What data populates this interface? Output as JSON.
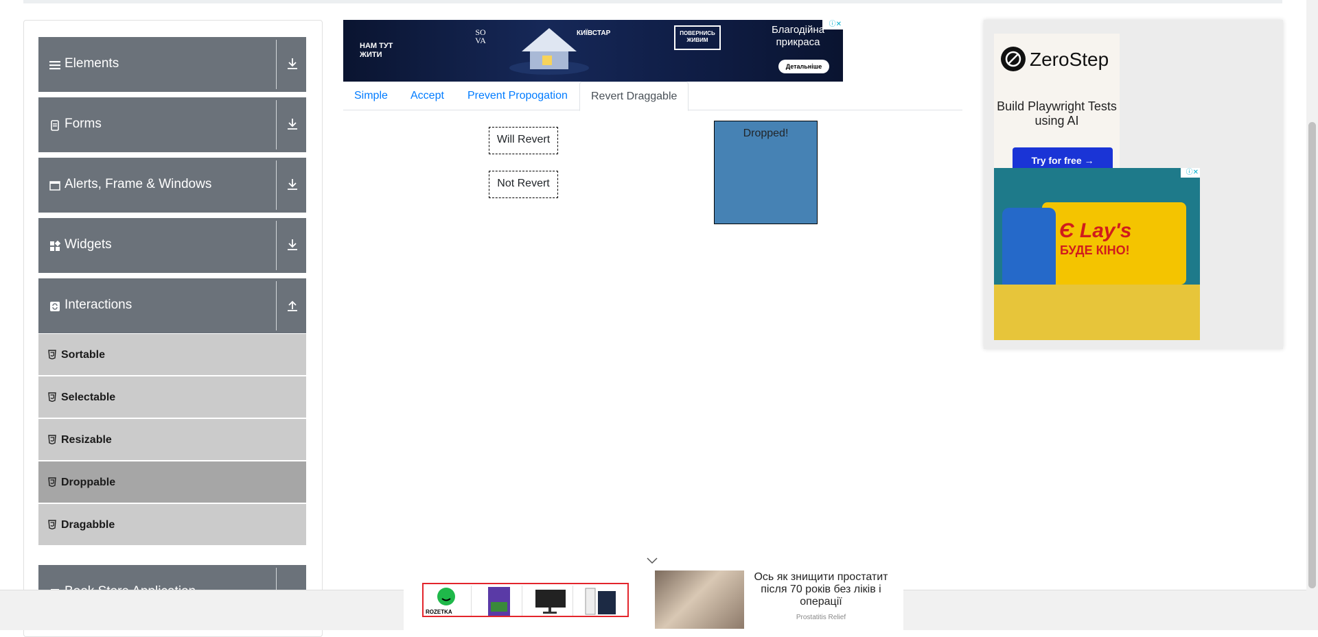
{
  "sidebar": {
    "groups": [
      {
        "label": "Elements",
        "icon": "list-icon"
      },
      {
        "label": "Forms",
        "icon": "form-icon"
      },
      {
        "label": "Alerts, Frame & Windows",
        "icon": "window-icon"
      },
      {
        "label": "Widgets",
        "icon": "widgets-icon"
      },
      {
        "label": "Interactions",
        "icon": "interactions-icon"
      },
      {
        "label": "Book Store Application",
        "icon": "book-icon"
      }
    ],
    "interaction_items": [
      {
        "label": "Sortable"
      },
      {
        "label": "Selectable"
      },
      {
        "label": "Resizable"
      },
      {
        "label": "Droppable"
      },
      {
        "label": "Dragabble"
      }
    ],
    "active_item": "Droppable"
  },
  "banner_ad": {
    "left_text": "НАМ ТУТ ЖИТИ",
    "brand": "SO VA",
    "operator": "КИЇВСТАР",
    "badge": "ПОВЕРНИСЬ ЖИВИМ",
    "headline": "Благодійна прикраса",
    "button": "Детальніше"
  },
  "tabs": [
    {
      "label": "Simple"
    },
    {
      "label": "Accept"
    },
    {
      "label": "Prevent Propogation"
    },
    {
      "label": "Revert Draggable"
    }
  ],
  "active_tab": "Revert Draggable",
  "draggables": {
    "will_revert": "Will Revert",
    "not_revert": "Not Revert"
  },
  "drop_target": {
    "text": "Dropped!"
  },
  "right_ad": {
    "brand": "ZeroStep",
    "tagline": "Build Playwright Tests using AI",
    "cta": "Try for free →",
    "lays_headline": "Lay's",
    "lays_sub": "БУДЕ КІНО!",
    "lays_prefix": "Є"
  },
  "bottom_ad": {
    "store_label": "ROZETKA",
    "article_text": "Ось як знищити простатит після 70 років без ліків і операції",
    "article_source": "Prostatitis Relief"
  },
  "colors": {
    "sidebar_group": "#6b727a",
    "menu_item": "#cbcbcb",
    "menu_item_active": "#a6a6a6",
    "link": "#007bff",
    "drop_target": "#4682b4",
    "cta": "#1a34d6"
  }
}
